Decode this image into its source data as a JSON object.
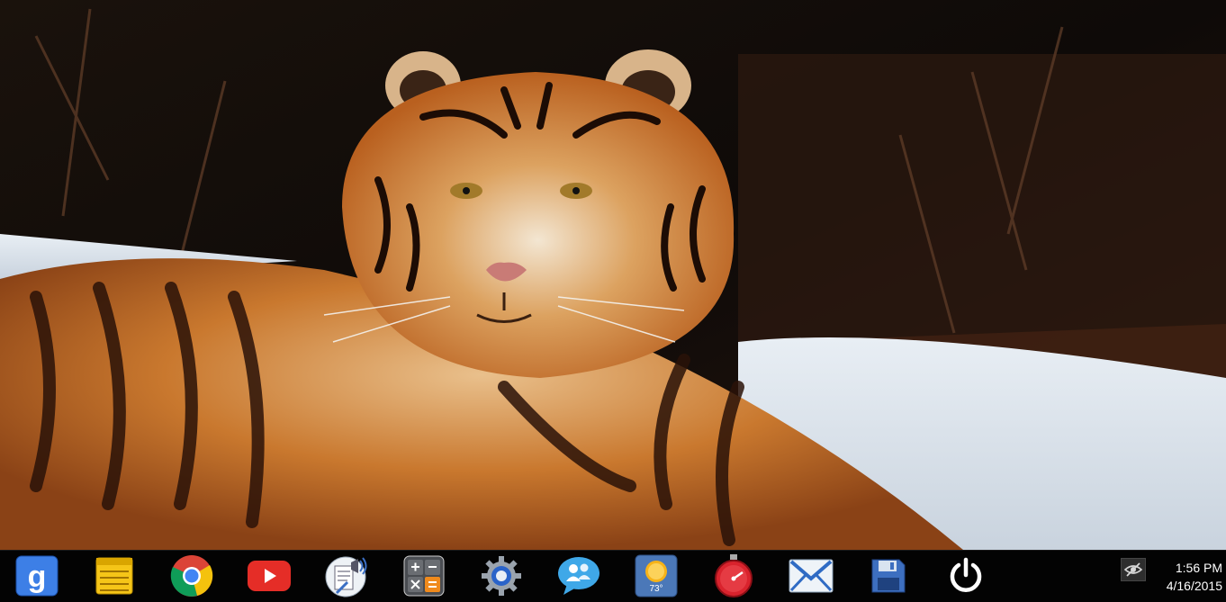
{
  "wallpaper": {
    "description_icon": "tiger-wallpaper"
  },
  "taskbar": {
    "apps": [
      {
        "name": "google-search",
        "icon": "google-icon"
      },
      {
        "name": "notes",
        "icon": "notes-icon"
      },
      {
        "name": "chrome",
        "icon": "chrome-icon"
      },
      {
        "name": "youtube",
        "icon": "youtube-icon"
      },
      {
        "name": "text-to-speech",
        "icon": "speech-document-icon"
      },
      {
        "name": "calculator",
        "icon": "calculator-icon"
      },
      {
        "name": "settings",
        "icon": "gear-icon"
      },
      {
        "name": "messenger",
        "icon": "chat-people-icon"
      },
      {
        "name": "weather",
        "icon": "weather-sun-icon",
        "temperature": "73°"
      },
      {
        "name": "stopwatch",
        "icon": "stopwatch-icon"
      },
      {
        "name": "mail",
        "icon": "mail-icon"
      },
      {
        "name": "save",
        "icon": "floppy-disk-icon"
      },
      {
        "name": "power",
        "icon": "power-icon"
      }
    ],
    "tray": {
      "visibility_icon": "eye-hidden-icon"
    },
    "clock": {
      "time": "1:56 PM",
      "date": "4/16/2015"
    }
  },
  "colors": {
    "taskbar_bg": "#030303",
    "text": "#ffffff"
  }
}
